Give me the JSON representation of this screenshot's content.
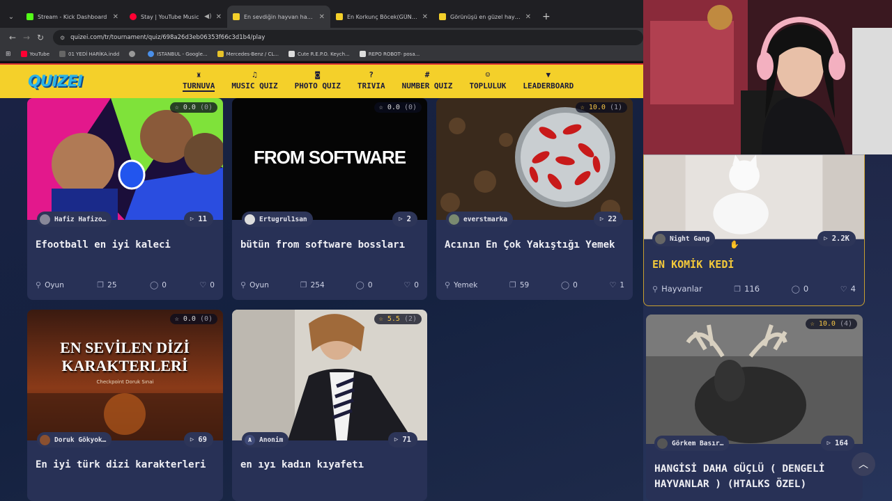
{
  "browser": {
    "tabs": [
      {
        "title": "Stream - Kick Dashboard",
        "favicon_color": "#53fc18",
        "active": false
      },
      {
        "title": "Stay | YouTube Music",
        "favicon_color": "#ff0033",
        "active": false,
        "audio": true
      },
      {
        "title": "En sevdiğin hayvan hangisi ? - ",
        "favicon_color": "#f4d02a",
        "active": true
      },
      {
        "title": "En Korkunç Böcek(GÜNCELLEN",
        "favicon_color": "#f4d02a",
        "active": false
      },
      {
        "title": "Görünüşü en güzel hayvan - Tu",
        "favicon_color": "#f4d02a",
        "active": false
      }
    ],
    "url": "quizei.com/tr/tournament/quiz/698a26d3eb06353f66c3d1b4/play",
    "bookmarks": [
      {
        "label": "YouTube",
        "color": "#ff0033"
      },
      {
        "label": "01 YEDİ HARİKA.indd",
        "color": "#888"
      },
      {
        "label": "",
        "color": "#aaa"
      },
      {
        "label": "ISTANBUL - Google...",
        "color": "#4a8fe8"
      },
      {
        "label": "Mercedes-Benz / CL...",
        "color": "#e6c229"
      },
      {
        "label": "Cute R.E.P.O. Keych...",
        "color": "#ddd"
      },
      {
        "label": "REPO ROBOT- posa...",
        "color": "#ddd"
      }
    ]
  },
  "site": {
    "logo": "QUIZEI",
    "nav": [
      {
        "label": "TURNUVA",
        "icon": "trophy-icon",
        "glyph": "♜",
        "active": true
      },
      {
        "label": "MUSIC QUIZ",
        "icon": "music-icon",
        "glyph": "♫",
        "active": false
      },
      {
        "label": "PHOTO QUIZ",
        "icon": "camera-icon",
        "glyph": "◙",
        "active": false
      },
      {
        "label": "TRIVIA",
        "icon": "question-icon",
        "glyph": "?",
        "active": false
      },
      {
        "label": "NUMBER QUIZ",
        "icon": "hash-icon",
        "glyph": "#",
        "active": false
      },
      {
        "label": "TOPLULUK",
        "icon": "users-icon",
        "glyph": "☺",
        "active": false
      },
      {
        "label": "LEADERBOARD",
        "icon": "medal-icon",
        "glyph": "▼",
        "active": false
      }
    ]
  },
  "cards": [
    {
      "title": "Efootball en iyi kaleci",
      "rating": "0.0",
      "rating_count": "(0)",
      "author": "Hafiz Hafizo…",
      "plays": "11",
      "category": "Oyun",
      "items": "25",
      "comments": "0",
      "likes": "0",
      "gold": false
    },
    {
      "title": "bütün from software bossları",
      "rating": "0.0",
      "rating_count": "(0)",
      "author": "Ertugrul1san",
      "plays": "2",
      "category": "Oyun",
      "items": "254",
      "comments": "0",
      "likes": "0",
      "gold": false,
      "image_text": "FROM SOFTWARE"
    },
    {
      "title": "Acının En Çok Yakıştığı Yemek",
      "rating": "10.0",
      "rating_count": "(1)",
      "author": "everstmarka",
      "plays": "22",
      "category": "Yemek",
      "items": "59",
      "comments": "0",
      "likes": "1",
      "gold": true
    },
    {
      "title": "EN KOMİK KEDİ",
      "rating": "",
      "rating_count": "",
      "author": "Night Gang",
      "plays": "2.2K",
      "category": "Hayvanlar",
      "items": "116",
      "comments": "0",
      "likes": "4",
      "gold": false
    },
    {
      "title": "En iyi türk dizi karakterleri",
      "rating": "0.0",
      "rating_count": "(0)",
      "author": "Doruk Gökyok…",
      "plays": "69",
      "category": "",
      "items": "",
      "comments": "",
      "likes": "",
      "gold": false,
      "image_text": "EN SEVİLEN DİZİ KARAKTERLERİ",
      "image_subtext": "Checkpoint Doruk Sınai"
    },
    {
      "title": "en ıyı kadın kıyafetı",
      "rating": "5.5",
      "rating_count": "(2)",
      "author": "Anonim",
      "author_initial": "A",
      "plays": "71",
      "category": "",
      "items": "",
      "comments": "",
      "likes": "",
      "gold": true
    },
    {
      "title": "HANGİSİ DAHA GÜÇLÜ ( DENGELİ HAYVANLAR ) (HTALKS ÖZEL)",
      "rating": "10.0",
      "rating_count": "(4)",
      "author": "Görkem Basır…",
      "plays": "164",
      "category": "",
      "items": "",
      "comments": "",
      "likes": "",
      "gold": true
    }
  ],
  "scroll_top_icon": "arrow-up-icon"
}
